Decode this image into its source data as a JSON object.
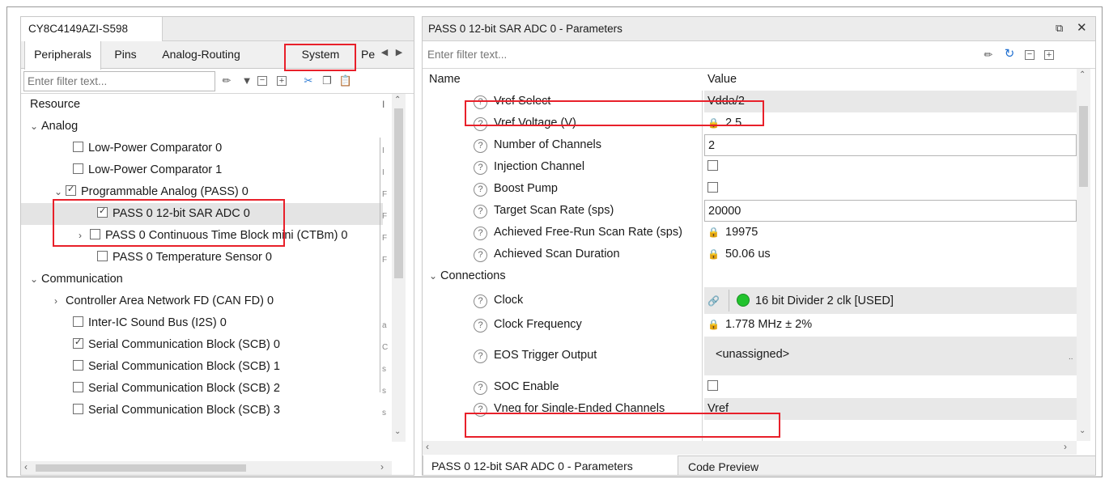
{
  "left_panel": {
    "title": "CY8C4149AZI-S598",
    "tabs": [
      "Peripherals",
      "Pins",
      "Analog-Routing",
      "System",
      "Pe"
    ],
    "filter_placeholder": "Enter filter text...",
    "column_header": "Resource",
    "tree": [
      {
        "label": "Analog",
        "level": 0,
        "type": "group",
        "expanded": true
      },
      {
        "label": "Low-Power Comparator 0",
        "level": 1,
        "checked": false,
        "col": "I"
      },
      {
        "label": "Low-Power Comparator 1",
        "level": 1,
        "checked": false,
        "col": "I"
      },
      {
        "label": "Programmable Analog (PASS) 0",
        "level": 1,
        "checked": true,
        "expanded": true,
        "col": "F"
      },
      {
        "label": "PASS 0 12-bit SAR ADC 0",
        "level": 2,
        "checked": true,
        "selected": true,
        "col": "F"
      },
      {
        "label": "PASS 0 Continuous Time Block mini (CTBm) 0",
        "level": 2,
        "checked": false,
        "collapsed": true,
        "col": "F"
      },
      {
        "label": "PASS 0 Temperature Sensor 0",
        "level": 2,
        "checked": false,
        "col": "F"
      },
      {
        "label": "Communication",
        "level": 0,
        "type": "group",
        "expanded": true
      },
      {
        "label": "Controller Area Network FD (CAN FD) 0",
        "level": 1,
        "type": "group",
        "collapsed": true
      },
      {
        "label": "Inter-IC Sound Bus (I2S) 0",
        "level": 1,
        "checked": false,
        "col": "a"
      },
      {
        "label": "Serial Communication Block (SCB) 0",
        "level": 1,
        "checked": true,
        "col": "C"
      },
      {
        "label": "Serial Communication Block (SCB) 1",
        "level": 1,
        "checked": false,
        "col": "s"
      },
      {
        "label": "Serial Communication Block (SCB) 2",
        "level": 1,
        "checked": false,
        "col": "s"
      },
      {
        "label": "Serial Communication Block (SCB) 3",
        "level": 1,
        "checked": false,
        "col": "s"
      }
    ]
  },
  "right_panel": {
    "title": "PASS 0 12-bit SAR ADC 0 - Parameters",
    "filter_placeholder": "Enter filter text...",
    "header_name": "Name",
    "header_value": "Value",
    "params": [
      {
        "name": "Vref Select",
        "value": "Vdda/2",
        "style": "grey"
      },
      {
        "name": "Vref Voltage (V)",
        "value": "2.5",
        "locked": true
      },
      {
        "name": "Number of Channels",
        "value": "2",
        "style": "box"
      },
      {
        "name": "Injection Channel",
        "value": "",
        "checkbox": true
      },
      {
        "name": "Boost Pump",
        "value": "",
        "checkbox": true
      },
      {
        "name": "Target Scan Rate (sps)",
        "value": "20000",
        "style": "box"
      },
      {
        "name": "Achieved Free-Run Scan Rate (sps)",
        "value": "19975",
        "locked": true
      },
      {
        "name": "Achieved Scan Duration",
        "value": "50.06 us",
        "locked": true
      }
    ],
    "group_connections": "Connections",
    "connections": [
      {
        "name": "Clock",
        "value": "16 bit Divider 2 clk [USED]"
      },
      {
        "name": "Clock Frequency",
        "value": "1.778 MHz ± 2%",
        "locked": true
      },
      {
        "name": "EOS Trigger Output",
        "value": "<unassigned>"
      },
      {
        "name": "SOC Enable",
        "value": ""
      },
      {
        "name": "Vneg for Single-Ended Channels",
        "value": "Vref"
      }
    ],
    "bottom_tabs": [
      "PASS 0 12-bit SAR ADC 0 - Parameters",
      "Code Preview"
    ]
  },
  "colors": {
    "highlight": "#e8202a",
    "status_green": "#22c32e"
  }
}
